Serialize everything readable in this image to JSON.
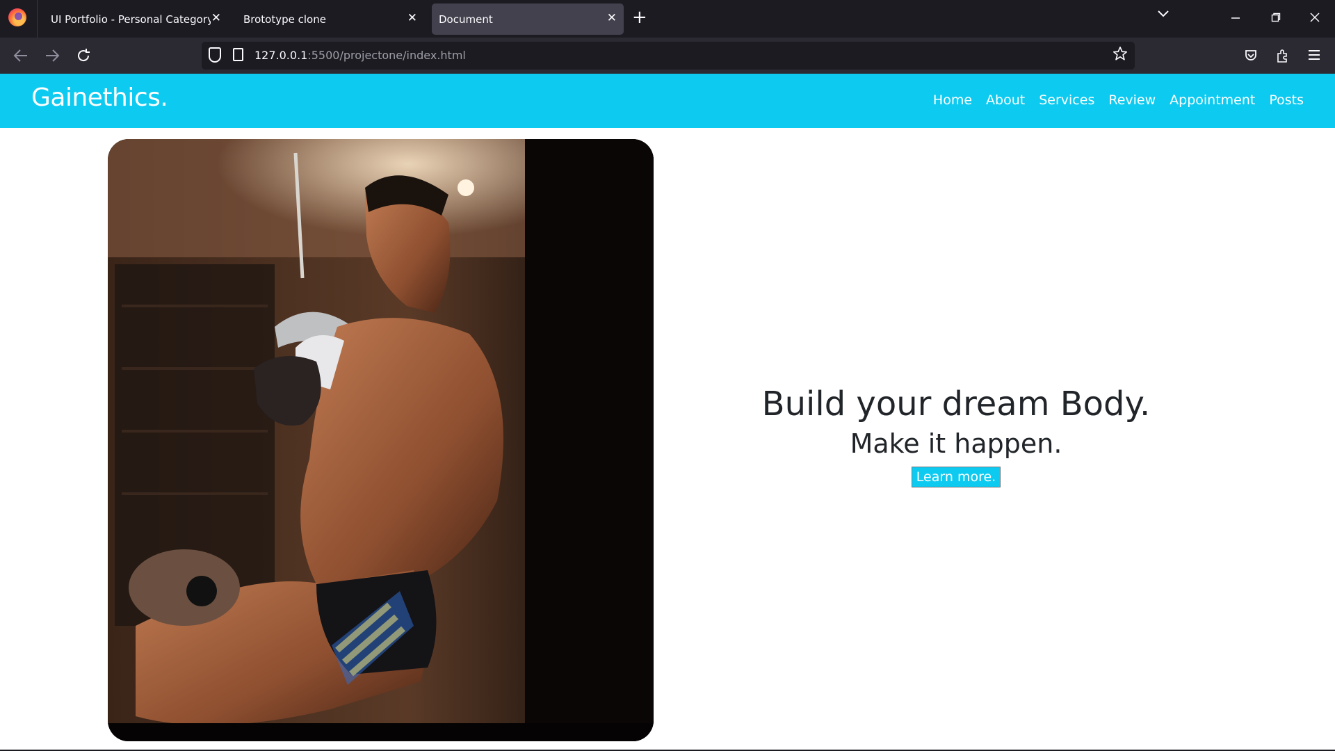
{
  "browser": {
    "tabs": [
      {
        "title": "UI Portfolio - Personal Category Boo",
        "active": false
      },
      {
        "title": "Brototype clone",
        "active": false
      },
      {
        "title": "Document",
        "active": true
      }
    ],
    "new_tab_icon": "+",
    "close_icon": "✕",
    "url_host": "127.0.0.1",
    "url_path": ":5500/projectone/index.html"
  },
  "site": {
    "brand": "Gainethics.",
    "nav": [
      "Home",
      "About",
      "Services",
      "Review",
      "Appointment",
      "Posts"
    ],
    "hero": {
      "headline": "Build your dream Body.",
      "subheadline": "Make it happen.",
      "cta_label": "Learn more."
    }
  },
  "colors": {
    "accent": "#0dcaf0",
    "browser_chrome": "#1c1b22",
    "toolbar": "#2b2a33",
    "active_tab": "#42414d",
    "page_text": "#212529"
  }
}
